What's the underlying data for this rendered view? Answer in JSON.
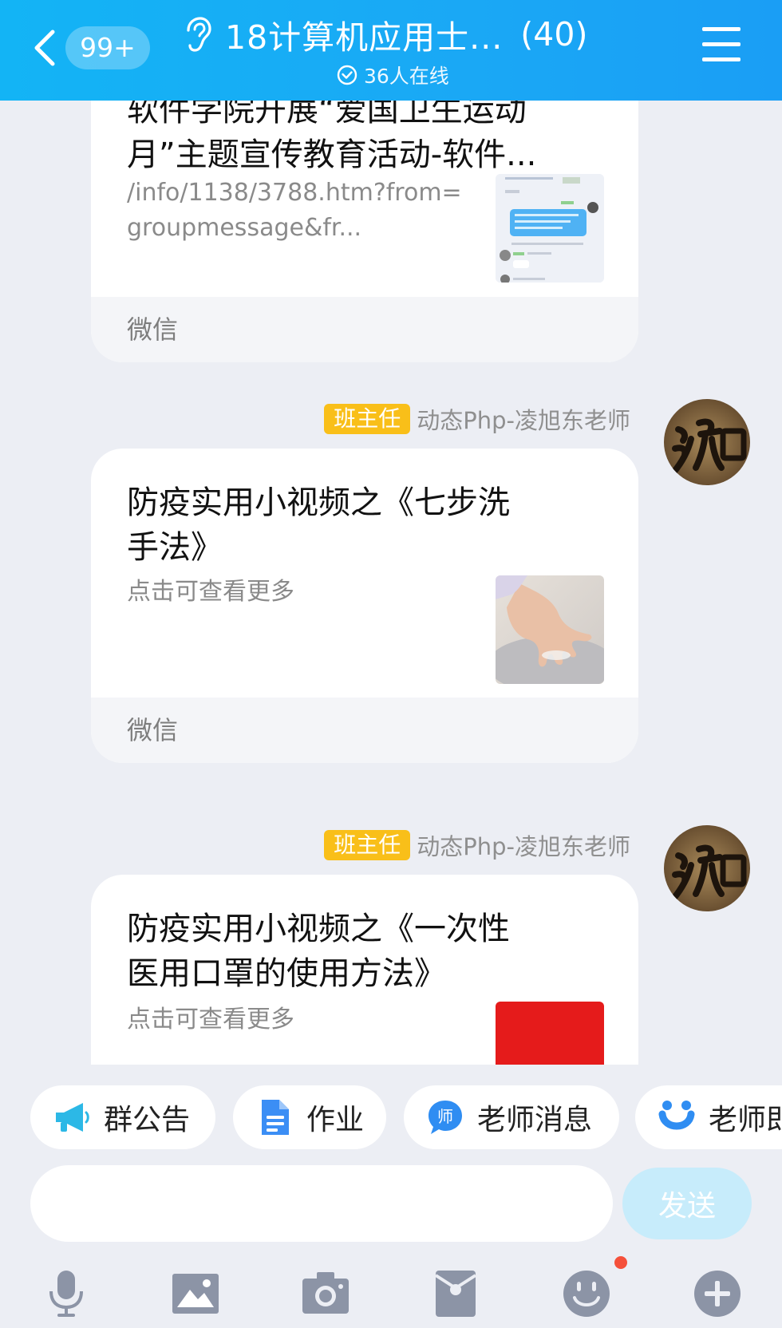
{
  "header": {
    "unread_count": "99+",
    "group_title": "18计算机应用士...",
    "member_count": "(40)",
    "online_status": "36人在线"
  },
  "messages": [
    {
      "title_line1": "软件学院开展“爱国卫生运动",
      "title_line2": "月”主题宣传教育活动-软件...",
      "desc_line1": "/info/1138/3788.htm?from=",
      "desc_line2": "groupmessage&fr...",
      "source": "微信"
    },
    {
      "role": "班主任",
      "sender": "动态Php-凌旭东老师",
      "title_line1": "防疫实用小视频之《七步洗",
      "title_line2": "手法》",
      "desc": "点击可查看更多",
      "source": "微信"
    },
    {
      "role": "班主任",
      "sender": "动态Php-凌旭东老师",
      "title_line1": "防疫实用小视频之《一次性",
      "title_line2": "医用口罩的使用方法》",
      "desc": "点击可查看更多"
    }
  ],
  "quick_actions": [
    {
      "label": "群公告",
      "icon": "megaphone-icon"
    },
    {
      "label": "作业",
      "icon": "document-icon"
    },
    {
      "label": "老师消息",
      "icon": "teacher-chat-icon"
    },
    {
      "label": "老师即",
      "icon": "smile-logo-icon"
    }
  ],
  "input": {
    "value": "",
    "send_label": "发送"
  },
  "toolbar": [
    "microphone-icon",
    "image-icon",
    "camera-icon",
    "red-packet-icon",
    "emoji-icon",
    "plus-icon"
  ],
  "colors": {
    "header_blue": "#15aef5",
    "role_badge": "#f9bf19",
    "send_button": "#c7ecfb",
    "notification_dot": "#f5503a"
  }
}
